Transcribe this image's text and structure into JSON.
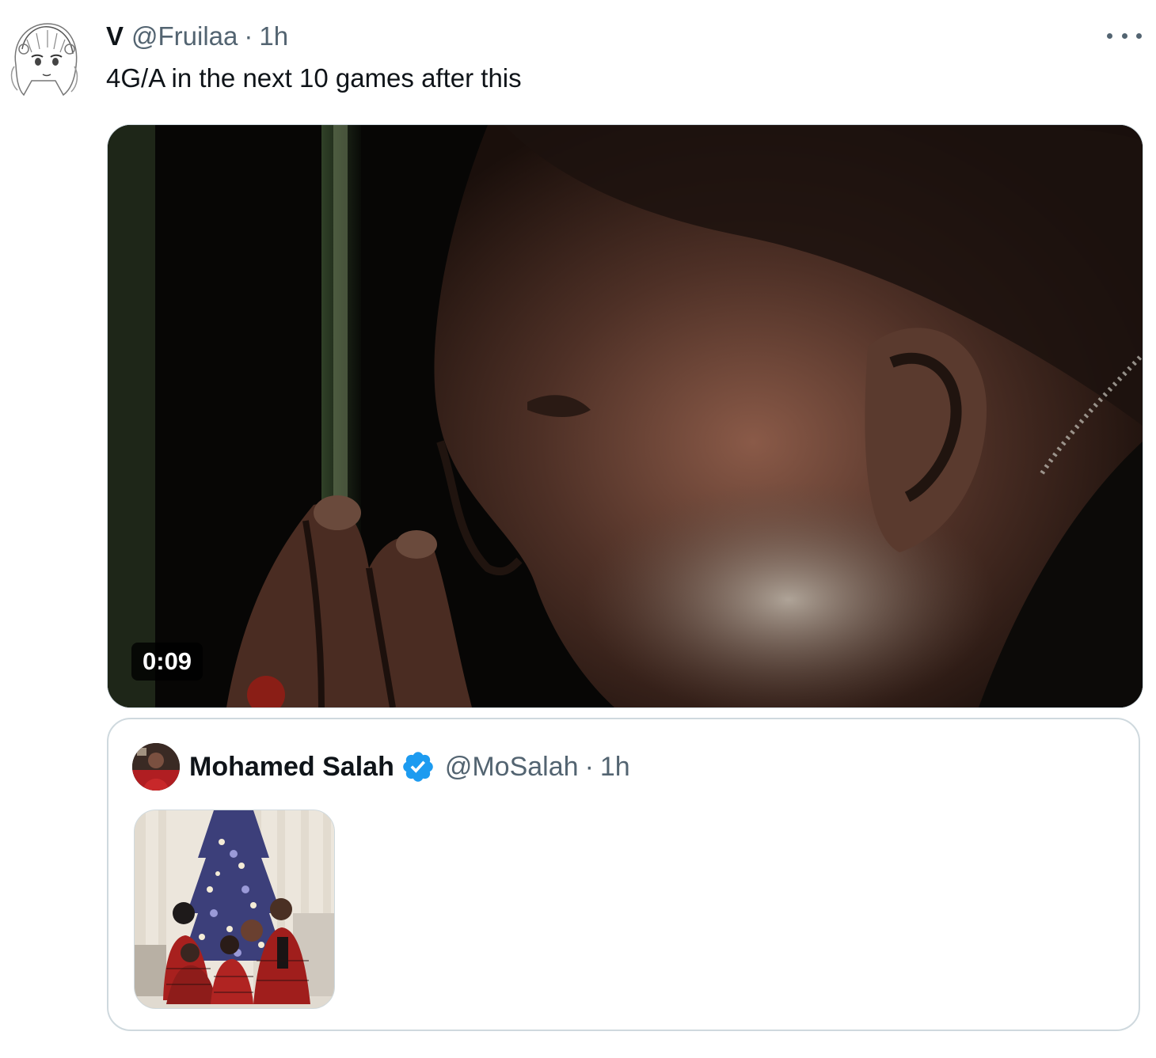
{
  "tweet": {
    "author_name": "V",
    "author_handle": "@Fruilaa",
    "separator": "·",
    "time": "1h",
    "text": "4G/A in the next 10 games after this",
    "more_icon": "more-horizontal-icon",
    "video": {
      "duration": "0:09"
    }
  },
  "quoted_tweet": {
    "author_name": "Mohamed Salah",
    "verified": true,
    "verified_color": "#1d9bf0",
    "author_handle": "@MoSalah",
    "separator": "·",
    "time": "1h"
  },
  "colors": {
    "text_primary": "#0f1419",
    "text_secondary": "#536471",
    "border": "#cfd9de"
  }
}
